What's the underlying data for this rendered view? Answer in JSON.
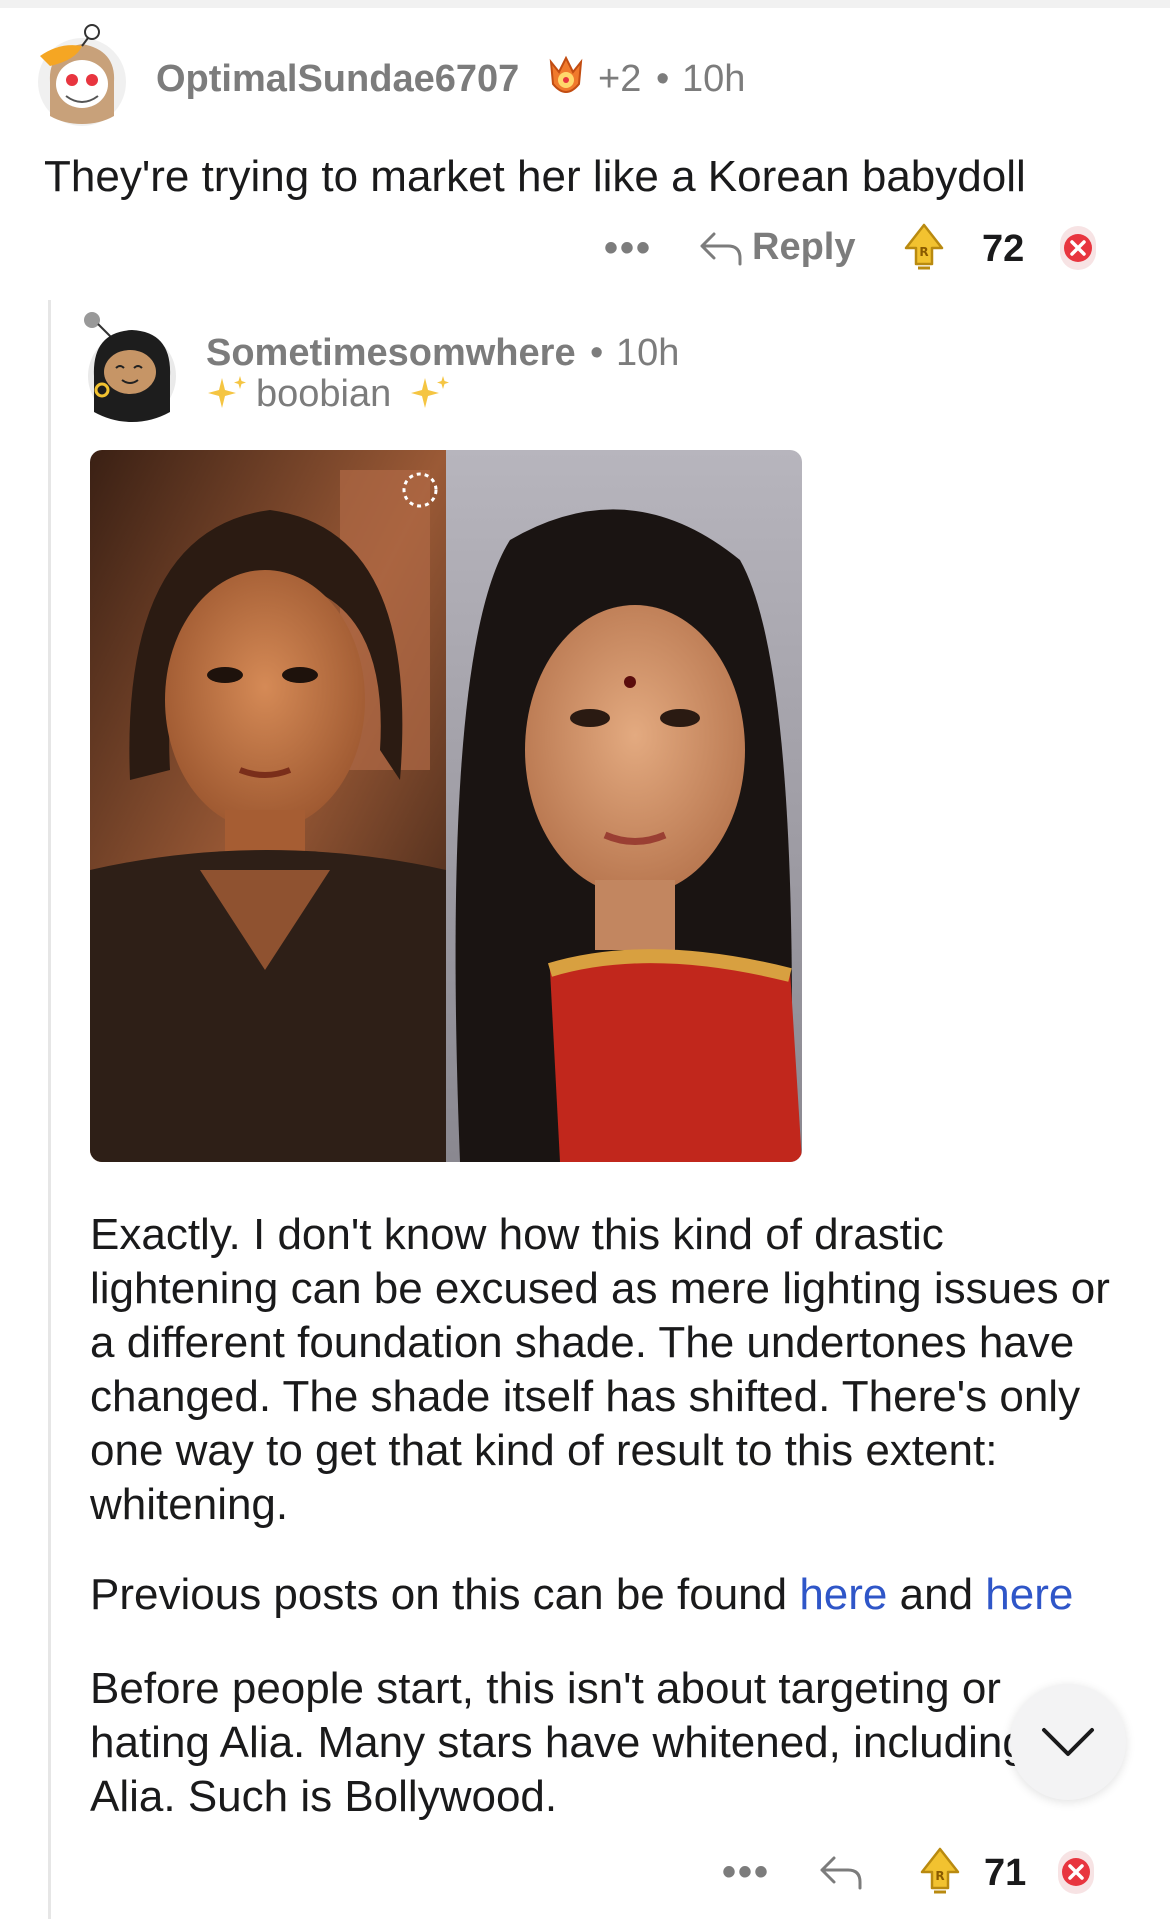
{
  "comment1": {
    "username": "OptimalSundae6707",
    "award_count": "+2",
    "separator": "•",
    "time": "10h",
    "text": "They're trying to market her like a Korean babydoll",
    "more_label": "•••",
    "reply_label": "Reply",
    "votes": "72",
    "icons": [
      "snoo-avatar-icon",
      "award-icon",
      "reply-arrow-icon",
      "upvote-icon",
      "downvote-icon"
    ]
  },
  "comment2": {
    "username": "Sometimesomwhere",
    "separator": "•",
    "time": "10h",
    "flair": "boobian",
    "paragraph1": "Exactly. I don't know how this kind of drastic lightening can be excused as mere lighting issues or a different foundation shade. The undertones have changed. The shade itself has shifted. There's only one way to get that kind of result to this extent: whitening.",
    "paragraph2_before": "Previous posts on this can be found ",
    "link1": "here",
    "paragraph2_middle": " and ",
    "link2": "here",
    "paragraph3": "Before people start, this isn't about targeting or hating Alia. Many stars have whitened, including Alia. Such is Bollywood.",
    "more_label": "•••",
    "votes": "71",
    "icons": [
      "snoo-avatar-icon",
      "sparkle-icon",
      "image-comparison",
      "reply-arrow-icon",
      "upvote-icon",
      "downvote-icon",
      "chevron-down-icon"
    ]
  },
  "colors": {
    "meta_gray": "#7c7c7c",
    "text": "#1a1a1b",
    "link": "#2f56c8",
    "upvote_gold": "#f2c230",
    "downvote_red": "#e8353f"
  }
}
